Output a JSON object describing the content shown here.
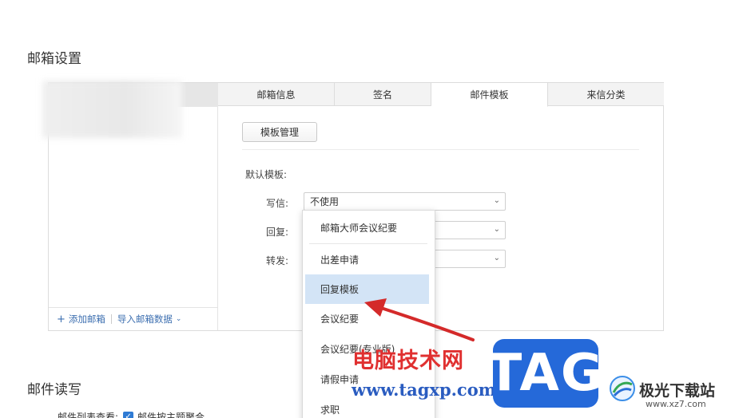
{
  "sections": {
    "mailbox_settings": "邮箱设置",
    "mail_reading": "邮件读写"
  },
  "left_panel": {
    "add_mailbox": "添加邮箱",
    "import_mailbox_data": "导入邮箱数据"
  },
  "tabs": [
    {
      "label": "邮箱信息",
      "active": false
    },
    {
      "label": "签名",
      "active": false
    },
    {
      "label": "邮件模板",
      "active": true
    },
    {
      "label": "来信分类",
      "active": false
    }
  ],
  "template": {
    "manage_button": "模板管理",
    "default_label": "默认模板:",
    "rows": [
      {
        "label": "写信:",
        "value": "不使用"
      },
      {
        "label": "回复:",
        "value": ""
      },
      {
        "label": "转发:",
        "value": ""
      }
    ]
  },
  "dropdown": {
    "items": [
      {
        "label": "邮箱大师会议纪要"
      },
      {
        "label": "出差申请"
      },
      {
        "label": "回复模板",
        "highlighted": true
      },
      {
        "label": "会议纪要"
      },
      {
        "label": "会议纪要(专业版)"
      },
      {
        "label": "请假申请"
      },
      {
        "label": "求职"
      }
    ]
  },
  "reading": {
    "list_label": "邮件列表查看:",
    "checkbox_label": "邮件按主题聚合"
  },
  "watermark": {
    "cn_text": "电脑技术网",
    "url": "www.tagxp.com",
    "tag": "TAG",
    "jg_text": "极光下载站",
    "jg_url": "www.xz7.com"
  },
  "colors": {
    "accent": "#2f7bd4",
    "highlight": "#d3e4f6",
    "arrow": "#d42a2a"
  }
}
